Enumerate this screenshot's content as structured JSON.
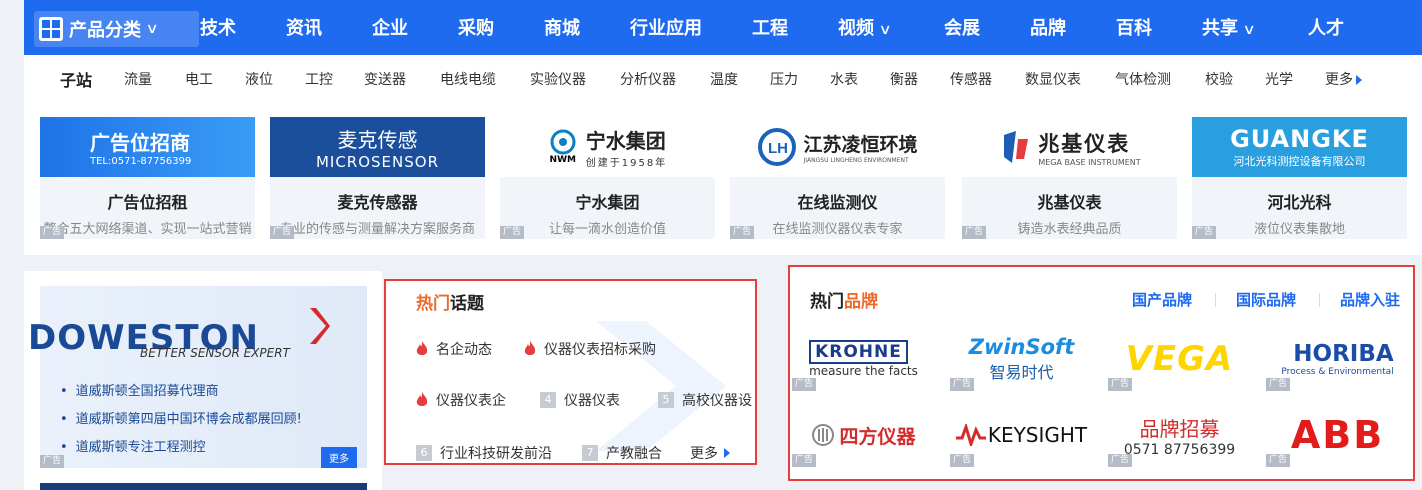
{
  "topnav": {
    "category_label": "产品分类",
    "items": [
      "技术",
      "资讯",
      "企业",
      "采购",
      "商城",
      "行业应用",
      "工程",
      "视频",
      "会展",
      "品牌",
      "百科",
      "共享",
      "人才"
    ]
  },
  "subnav": {
    "label": "子站",
    "items": [
      "流量",
      "电工",
      "液位",
      "工控",
      "变送器",
      "电线电缆",
      "实验仪器",
      "分析仪器",
      "温度",
      "压力",
      "水表",
      "衡器",
      "传感器",
      "数显仪表",
      "气体检测",
      "校验",
      "光学"
    ],
    "more": "更多"
  },
  "ads": [
    {
      "logo_line1": "广告位招商",
      "logo_line2": "TEL:0571-87756399",
      "title": "广告位招租",
      "desc": "整合五大网络渠道、实现一站式营销",
      "tag": "广告"
    },
    {
      "logo_line1": "麦克传感",
      "logo_line2": "MICROSENSOR",
      "title": "麦克传感器",
      "desc": "专业的传感与测量解决方案服务商",
      "tag": "广告"
    },
    {
      "logo_line1": "宁水集团",
      "logo_line2": "创建于1958年",
      "logo_mark": "NWM",
      "title": "宁水集团",
      "desc": "让每一滴水创造价值",
      "tag": "广告"
    },
    {
      "logo_line1": "江苏凌恒环境",
      "logo_line2": "JIANGSU LINGHENG ENVIRONMENT",
      "title": "在线监测仪",
      "desc": "在线监测仪器仪表专家",
      "tag": "广告"
    },
    {
      "logo_line1": "兆基仪表",
      "logo_line2": "MEGA BASE INSTRUMENT",
      "title": "兆基仪表",
      "desc": "铸造水表经典品质",
      "tag": "广告"
    },
    {
      "logo_line1": "GUANGKE",
      "logo_line2": "河北光科测控设备有限公司",
      "title": "河北光科",
      "desc": "液位仪表集散地",
      "tag": "广告"
    }
  ],
  "doweston": {
    "brand": "DOWESTON",
    "slogan": "BETTER SENSOR EXPERT",
    "items": [
      "道威斯顿全国招募代理商",
      "道威斯顿第四届中国环博会成都展回顾!",
      "道威斯顿专注工程测控"
    ],
    "more": "更多",
    "tag": "广告"
  },
  "topics": {
    "title_a": "热门",
    "title_b": "话题",
    "items": [
      {
        "label": "名企动态",
        "marker": "hot"
      },
      {
        "label": "仪器仪表招标采购",
        "marker": "hot"
      },
      {
        "label": "仪器仪表企",
        "marker": "hot"
      },
      {
        "label": "仪器仪表",
        "marker": "4"
      },
      {
        "label": "高校仪器设",
        "marker": "5"
      },
      {
        "label": "行业科技研发前沿",
        "marker": "6"
      },
      {
        "label": "产教融合",
        "marker": "7"
      }
    ],
    "more": "更多"
  },
  "brands": {
    "title_a": "热门",
    "title_b": "品牌",
    "links": [
      "国产品牌",
      "国际品牌",
      "品牌入驻"
    ],
    "logos": [
      {
        "name": "KROHNE",
        "sub": "measure the facts"
      },
      {
        "name": "ZwinSoft",
        "sub": "智易时代"
      },
      {
        "name": "VEGA",
        "sub": ""
      },
      {
        "name": "HORIBA",
        "sub": "Process & Environmental"
      },
      {
        "name": "四方仪器",
        "sub": ""
      },
      {
        "name": "KEYSIGHT",
        "sub": ""
      },
      {
        "name": "品牌招募",
        "sub": "0571 87756399"
      },
      {
        "name": "ABB",
        "sub": ""
      }
    ],
    "tag": "广告"
  },
  "colors": {
    "accent": "#1e6bf0",
    "highlight_border": "#e53e3e",
    "hot": "#ee6a2b"
  }
}
